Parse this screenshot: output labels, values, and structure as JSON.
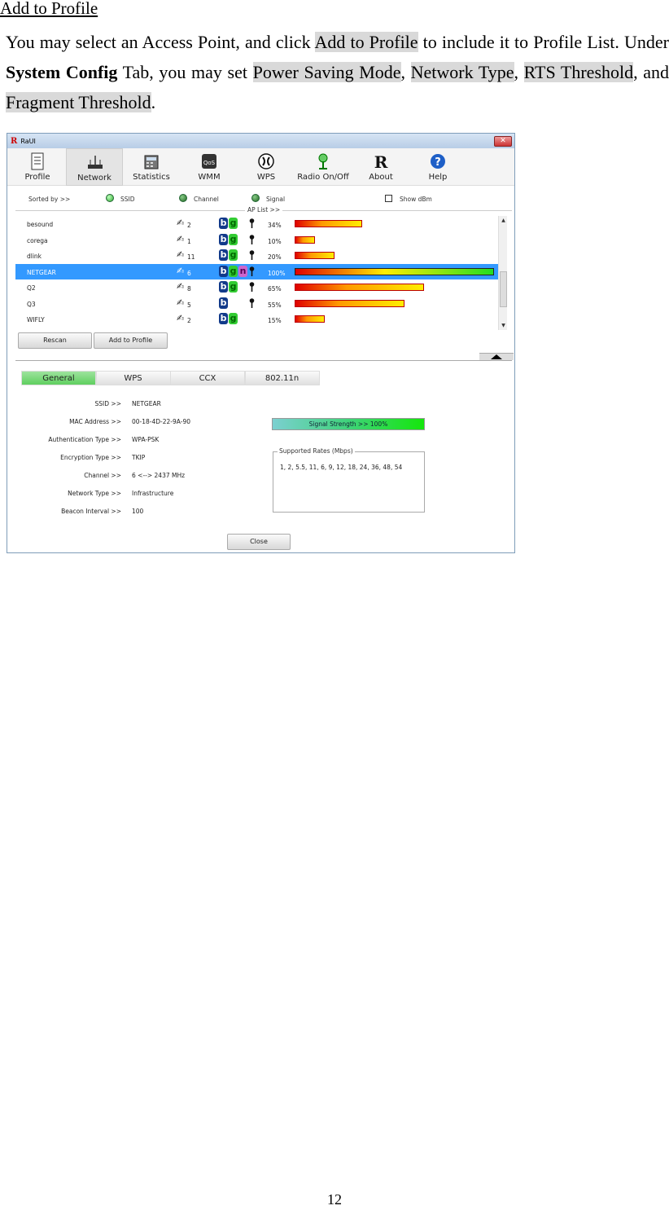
{
  "doc": {
    "heading": "Add to Profile",
    "para": [
      {
        "t": "You may select an Access Point, and click ",
        "s": ""
      },
      {
        "t": "Add to Profile",
        "s": "hl"
      },
      {
        "t": " to include it to Profile List. Under ",
        "s": ""
      },
      {
        "t": "System Config",
        "s": "b"
      },
      {
        "t": " Tab, you may set ",
        "s": ""
      },
      {
        "t": "Power Saving Mode",
        "s": "hl"
      },
      {
        "t": ", ",
        "s": ""
      },
      {
        "t": "Network Type",
        "s": "hl"
      },
      {
        "t": ", ",
        "s": ""
      },
      {
        "t": "RTS Threshold",
        "s": "hl"
      },
      {
        "t": ", and ",
        "s": ""
      },
      {
        "t": "Fragment Threshold",
        "s": "hl"
      },
      {
        "t": ".",
        "s": ""
      }
    ],
    "page_number": "12"
  },
  "window": {
    "title": "RaUI",
    "logo": "R",
    "close_glyph": "✕",
    "toolbar": [
      {
        "label": "Profile",
        "icon": "profile-icon"
      },
      {
        "label": "Network",
        "icon": "network-icon",
        "active": true
      },
      {
        "label": "Statistics",
        "icon": "statistics-icon"
      },
      {
        "label": "WMM",
        "icon": "wmm-icon"
      },
      {
        "label": "WPS",
        "icon": "wps-icon"
      },
      {
        "label": "Radio On/Off",
        "icon": "radio-icon"
      },
      {
        "label": "About",
        "icon": "about-icon"
      },
      {
        "label": "Help",
        "icon": "help-icon"
      }
    ],
    "sort": {
      "sorted_by": "Sorted by >>",
      "ssid": "SSID",
      "channel": "Channel",
      "signal": "Signal",
      "show_dbm": "Show dBm"
    },
    "ap_list_label": "AP List >>",
    "ap_list": [
      {
        "ssid": "besound",
        "channel": "2",
        "modes": [
          "b",
          "g"
        ],
        "secure": true,
        "signal": 34
      },
      {
        "ssid": "corega",
        "channel": "1",
        "modes": [
          "b",
          "g"
        ],
        "secure": true,
        "signal": 10
      },
      {
        "ssid": "dlink",
        "channel": "11",
        "modes": [
          "b",
          "g"
        ],
        "secure": true,
        "signal": 20
      },
      {
        "ssid": "NETGEAR",
        "channel": "6",
        "modes": [
          "b",
          "g",
          "n"
        ],
        "secure": true,
        "signal": 100,
        "selected": true
      },
      {
        "ssid": "Q2",
        "channel": "8",
        "modes": [
          "b",
          "g"
        ],
        "secure": true,
        "signal": 65
      },
      {
        "ssid": "Q3",
        "channel": "5",
        "modes": [
          "b"
        ],
        "secure": true,
        "signal": 55
      },
      {
        "ssid": "WIFLY",
        "channel": "2",
        "modes": [
          "b",
          "g"
        ],
        "secure": false,
        "signal": 15
      }
    ],
    "buttons": {
      "rescan": "Rescan",
      "add_to_profile": "Add to Profile",
      "close": "Close"
    },
    "tabs": [
      "General",
      "WPS",
      "CCX",
      "802.11n"
    ],
    "details": [
      {
        "k": "SSID >>",
        "v": "NETGEAR"
      },
      {
        "k": "MAC Address >>",
        "v": "00-18-4D-22-9A-90"
      },
      {
        "k": "Authentication Type >>",
        "v": "WPA-PSK"
      },
      {
        "k": "Encryption Type >>",
        "v": "TKIP"
      },
      {
        "k": "Channel >>",
        "v": "6 <--> 2437 MHz"
      },
      {
        "k": "Network Type >>",
        "v": "Infrastructure"
      },
      {
        "k": "Beacon Interval >>",
        "v": "100"
      }
    ],
    "signal_strength": "Signal Strength >> 100%",
    "supported_rates_label": "Supported Rates (Mbps)",
    "supported_rates": "1, 2, 5.5, 11, 6, 9, 12, 18, 24, 36, 48, 54",
    "colors": {
      "selection": "#3399ff",
      "bar_low": "#e00000",
      "bar_high": "#ffee00",
      "bar_full": "#22dd22"
    }
  }
}
